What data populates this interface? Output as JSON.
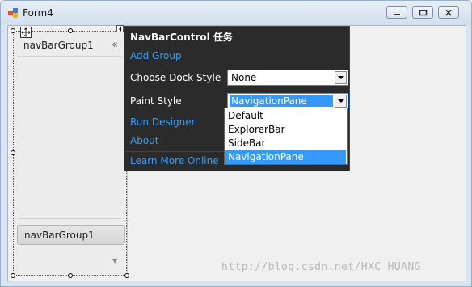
{
  "window": {
    "title": "Form4"
  },
  "navbar": {
    "group_header_label": "navBarGroup1",
    "collapse_glyph": "«",
    "group_button_label": "navBarGroup1",
    "overflow_glyph": "▼"
  },
  "smart_tag_panel": {
    "title": "NavBarControl 任务",
    "add_group": "Add Group",
    "dock_style_label": "Choose Dock Style",
    "dock_style_value": "None",
    "paint_style_label": "Paint Style",
    "paint_style_value": "NavigationPane",
    "run_designer": "Run Designer",
    "about": "About",
    "learn_more": "Learn More Online"
  },
  "paint_style_options": [
    "Default",
    "ExplorerBar",
    "SideBar",
    "NavigationPane"
  ],
  "paint_style_selected_index": 3,
  "watermark": "http://blog.csdn.net/HXC_HUANG",
  "colors": {
    "link": "#3c9bf0",
    "selection": "#3399ff",
    "panel_bg": "#2b2b2b"
  },
  "icons": [
    "app-icon",
    "minimize-icon",
    "maximize-icon",
    "close-icon",
    "move-icon",
    "smart-tag-icon",
    "dropdown-arrow-icon"
  ]
}
